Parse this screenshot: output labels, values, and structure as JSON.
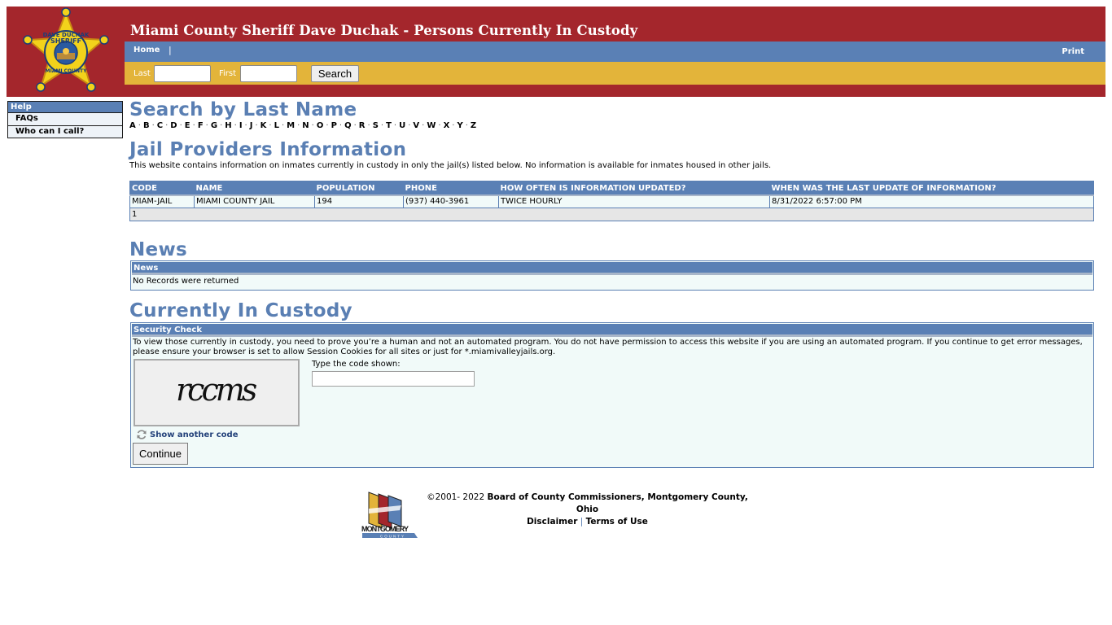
{
  "header": {
    "title": "Miami County Sheriff Dave Duchak - Persons Currently In Custody",
    "badge_top_text": "DAVE DUCHAK",
    "badge_mid_text": "SHERIFF",
    "badge_bottom_text": "MIAMI COUNTY",
    "nav": {
      "home_label": "Home",
      "separator": "|",
      "print_label": "Print"
    },
    "search": {
      "last_label": "Last",
      "last_value": "",
      "first_label": "First",
      "first_value": "",
      "search_label": "Search"
    }
  },
  "sidebar": {
    "heading": "Help",
    "items": [
      {
        "label": "FAQs"
      },
      {
        "label": "Who can I call?"
      }
    ]
  },
  "search_by_last_name": {
    "heading": "Search by Last Name",
    "letters": [
      "A",
      "B",
      "C",
      "D",
      "E",
      "F",
      "G",
      "H",
      "I",
      "J",
      "K",
      "L",
      "M",
      "N",
      "O",
      "P",
      "Q",
      "R",
      "S",
      "T",
      "U",
      "V",
      "W",
      "X",
      "Y",
      "Z"
    ],
    "separator": "·"
  },
  "jail_providers": {
    "heading": "Jail Providers Information",
    "description": "This website contains information on inmates currently in custody in only the jail(s) listed below. No information is available for inmates housed in other jails.",
    "columns": [
      "CODE",
      "NAME",
      "POPULATION",
      "PHONE",
      "HOW OFTEN IS INFORMATION UPDATED?",
      "WHEN WAS THE LAST UPDATE OF INFORMATION?"
    ],
    "rows": [
      [
        "MIAM-JAIL",
        "MIAMI COUNTY JAIL",
        "194",
        "(937) 440-3961",
        "TWICE HOURLY",
        "8/31/2022 6:57:00 PM"
      ]
    ],
    "pager": "1"
  },
  "news": {
    "heading": "News",
    "panel_header": "News",
    "message": "No Records were returned"
  },
  "custody": {
    "heading": "Currently In Custody",
    "panel_header": "Security Check",
    "instructions": "To view those currently in custody, you need to prove you’re a human and not an automated program. You do not have permission to access this website if you are using an automated program. If you continue to get error messages, please ensure your browser is set to allow Session Cookies for all sites or just for *.miamivalleyjails.org.",
    "captcha_code": "rccms",
    "code_label": "Type the code shown:",
    "code_value": "",
    "refresh_label": "Show another code",
    "continue_label": "Continue"
  },
  "footer": {
    "copyright_prefix": "©2001- 2022",
    "organization": "Board of County Commissioners, Montgomery County, Ohio",
    "disclaimer_label": "Disclaimer",
    "separator": "|",
    "terms_label": "Terms of Use",
    "logo_text": "MONTGOMERY",
    "logo_subtext": "COUNTY"
  },
  "colors": {
    "header_red": "#a4262c",
    "nav_blue": "#5a80b5",
    "search_gold": "#e3b43a",
    "heading_blue": "#5a7fb3",
    "panel_bg": "#f1faf9"
  }
}
